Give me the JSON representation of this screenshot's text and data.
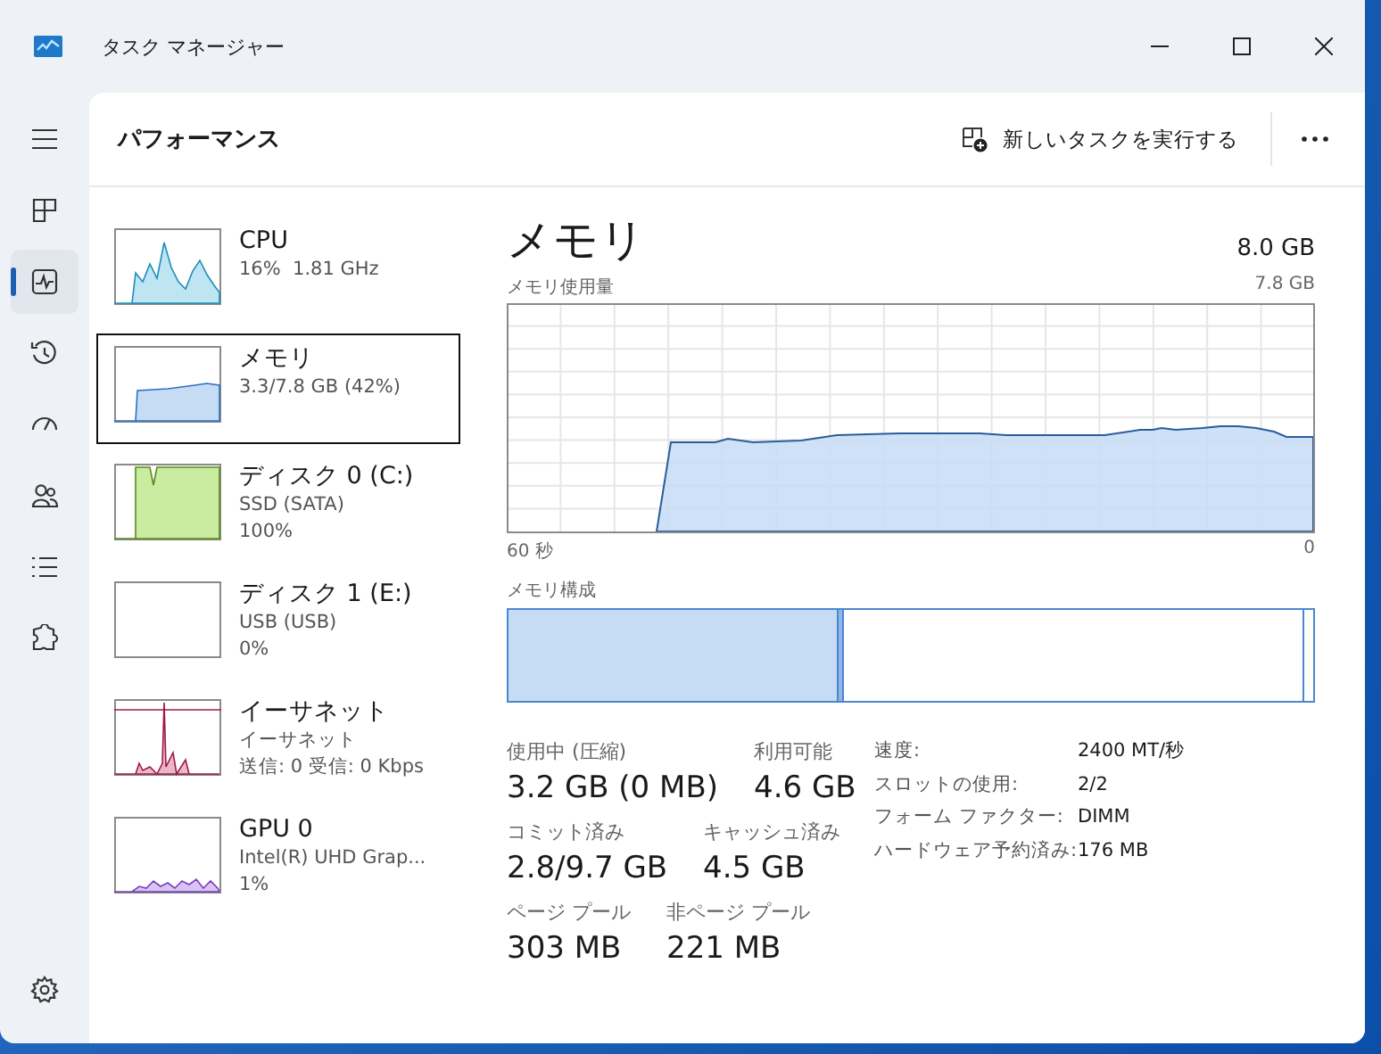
{
  "window": {
    "title": "タスク マネージャー"
  },
  "nav": [
    {
      "kind": "menu",
      "selected": false
    },
    {
      "kind": "processes",
      "selected": false
    },
    {
      "kind": "performance",
      "selected": true
    },
    {
      "kind": "history",
      "selected": false
    },
    {
      "kind": "startup",
      "selected": false
    },
    {
      "kind": "users",
      "selected": false
    },
    {
      "kind": "details",
      "selected": false
    },
    {
      "kind": "services",
      "selected": false
    }
  ],
  "nav_bottom": [
    {
      "kind": "settings",
      "selected": false
    }
  ],
  "page_title": "パフォーマンス",
  "toolbar": {
    "run_new_task": "新しいタスクを実行する"
  },
  "devices": [
    {
      "kind": "cpu",
      "name": "CPU",
      "details": [
        "16%  1.81 GHz"
      ],
      "selected": false
    },
    {
      "kind": "memory",
      "name": "メモリ",
      "details": [
        "3.3/7.8 GB (42%)"
      ],
      "selected": true
    },
    {
      "kind": "disk",
      "name": "ディスク 0 (C:)",
      "details": [
        "SSD (SATA)",
        "100%"
      ],
      "selected": false
    },
    {
      "kind": "idle",
      "name": "ディスク 1 (E:)",
      "details": [
        "USB (USB)",
        "0%"
      ],
      "selected": false
    },
    {
      "kind": "ethernet",
      "name": "イーサネット",
      "details": [
        "イーサネット",
        "送信: 0 受信: 0 Kbps"
      ],
      "selected": false
    },
    {
      "kind": "gpu",
      "name": "GPU 0",
      "details": [
        "Intel(R) UHD Grap...",
        "1%"
      ],
      "selected": false
    }
  ],
  "detail": {
    "title": "メモリ",
    "total": "8.0 GB",
    "usage_label": "メモリ使用量",
    "usage_max": "7.8 GB",
    "time_start": "60 秒",
    "time_end": "0",
    "composition_label": "メモリ構成",
    "stats": [
      [
        {
          "label": "使用中 (圧縮)",
          "value": "3.2 GB (0 MB)"
        },
        {
          "label": "利用可能",
          "value": "4.6 GB"
        }
      ],
      [
        {
          "label": "コミット済み",
          "value": "2.8/9.7 GB"
        },
        {
          "label": "キャッシュ済み",
          "value": "4.5 GB"
        }
      ],
      [
        {
          "label": "ページ プール",
          "value": "303 MB"
        },
        {
          "label": "非ページ プール",
          "value": "221 MB"
        }
      ]
    ],
    "specs": [
      {
        "label": "速度:",
        "value": "2400 MT/秒"
      },
      {
        "label": "スロットの使用:",
        "value": "2/2"
      },
      {
        "label": "フォーム ファクター:",
        "value": "DIMM"
      },
      {
        "label": "ハードウェア予約済み:",
        "value": "176 MB"
      }
    ]
  }
}
